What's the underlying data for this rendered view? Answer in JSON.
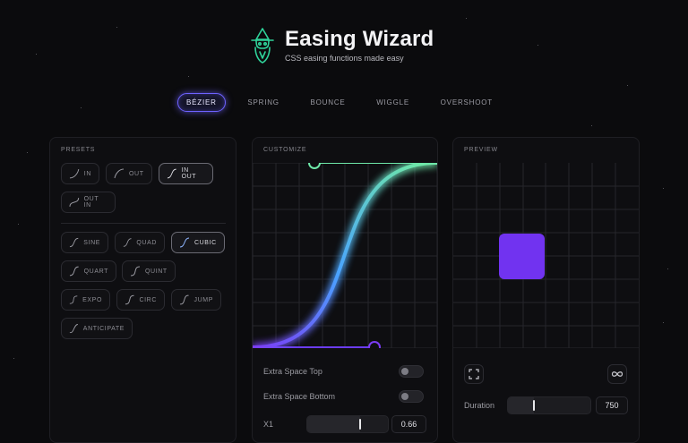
{
  "brand": {
    "title": "Easing Wizard",
    "subtitle": "CSS easing functions made easy"
  },
  "tabs": [
    {
      "label": "BÉZIER",
      "active": true
    },
    {
      "label": "SPRING",
      "active": false
    },
    {
      "label": "BOUNCE",
      "active": false
    },
    {
      "label": "WIGGLE",
      "active": false
    },
    {
      "label": "OVERSHOOT",
      "active": false
    }
  ],
  "presets": {
    "title": "PRESETS",
    "directions": [
      {
        "label": "IN",
        "active": false
      },
      {
        "label": "OUT",
        "active": false
      },
      {
        "label": "IN OUT",
        "active": true
      },
      {
        "label": "OUT IN",
        "active": false
      }
    ],
    "curves": [
      {
        "label": "SINE",
        "active": false
      },
      {
        "label": "QUAD",
        "active": false
      },
      {
        "label": "CUBIC",
        "active": true
      },
      {
        "label": "QUART",
        "active": false
      },
      {
        "label": "QUINT",
        "active": false
      },
      {
        "label": "EXPO",
        "active": false
      },
      {
        "label": "CIRC",
        "active": false
      },
      {
        "label": "JUMP",
        "active": false
      },
      {
        "label": "ANTICIPATE",
        "active": false
      }
    ]
  },
  "customize": {
    "title": "CUSTOMIZE",
    "extra_top_label": "Extra Space Top",
    "extra_top_on": false,
    "extra_bottom_label": "Extra Space Bottom",
    "extra_bottom_on": false,
    "x1_label": "X1",
    "x1_value": "0.66",
    "x1_fraction": 0.66
  },
  "preview": {
    "title": "PREVIEW",
    "duration_label": "Duration",
    "duration_value": "750",
    "duration_fraction": 0.32
  },
  "colors": {
    "accent": "#6e62ff",
    "curve_start": "#7b3cf5",
    "curve_end": "#6ee7a8",
    "preview_box": "#7133f0"
  },
  "icons": {
    "logo": "wizard-icon",
    "fullscreen": "fullscreen-icon",
    "loop": "infinity-icon"
  }
}
